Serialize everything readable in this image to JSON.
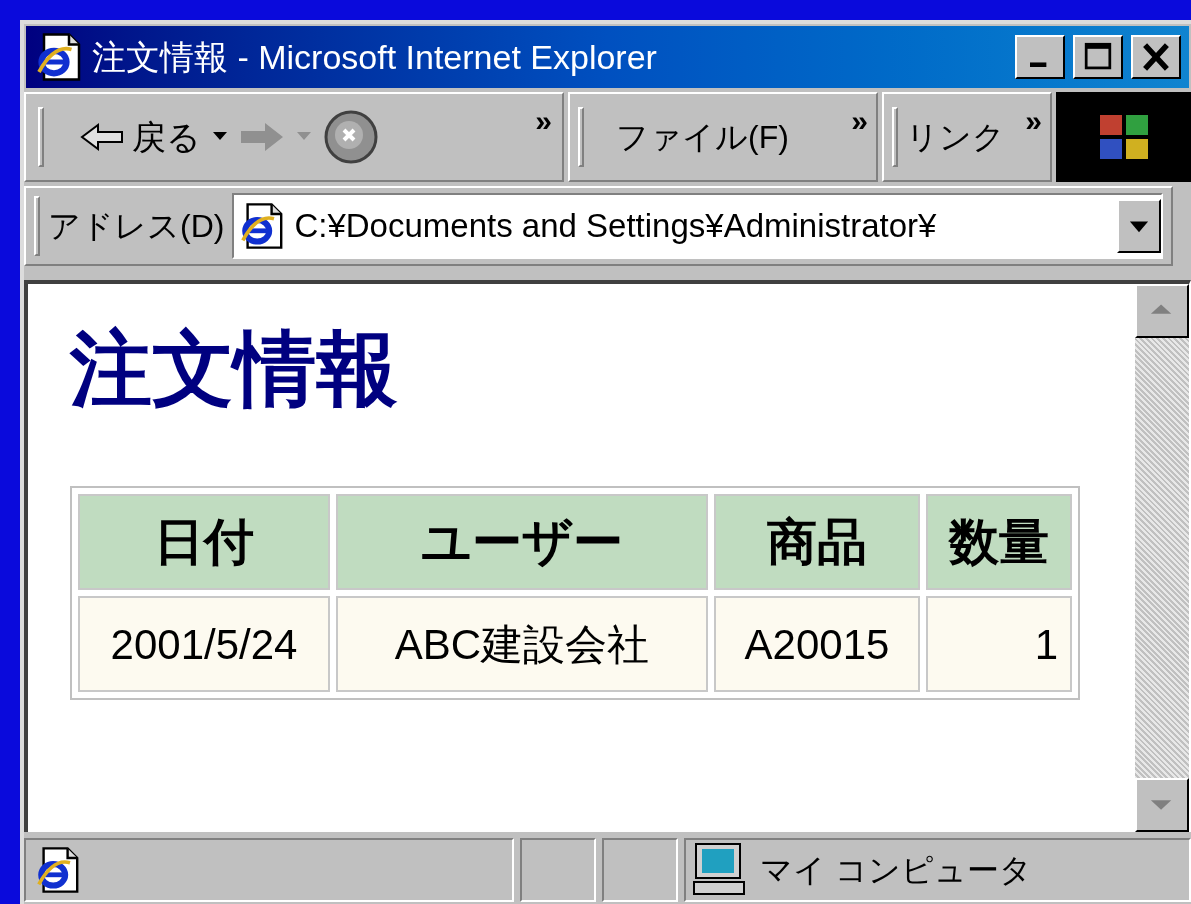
{
  "window": {
    "title": "注文情報 - Microsoft Internet Explorer"
  },
  "toolbar": {
    "back_label": "戻る",
    "chevron": "»",
    "menu": "ファイル(F)",
    "menu_chevron": "»",
    "links": "リンク",
    "links_chevron": "»"
  },
  "address_bar": {
    "label": "アドレス(D)",
    "value": "C:¥Documents and Settings¥Administrator¥"
  },
  "page": {
    "heading": "注文情報",
    "table": {
      "columns": [
        "日付",
        "ユーザー",
        "商品",
        "数量"
      ],
      "rows": [
        [
          "2001/5/24",
          "ABC建設会社",
          "A20015",
          "1"
        ]
      ]
    }
  },
  "status_bar": {
    "zone": "マイ コンピュータ"
  }
}
